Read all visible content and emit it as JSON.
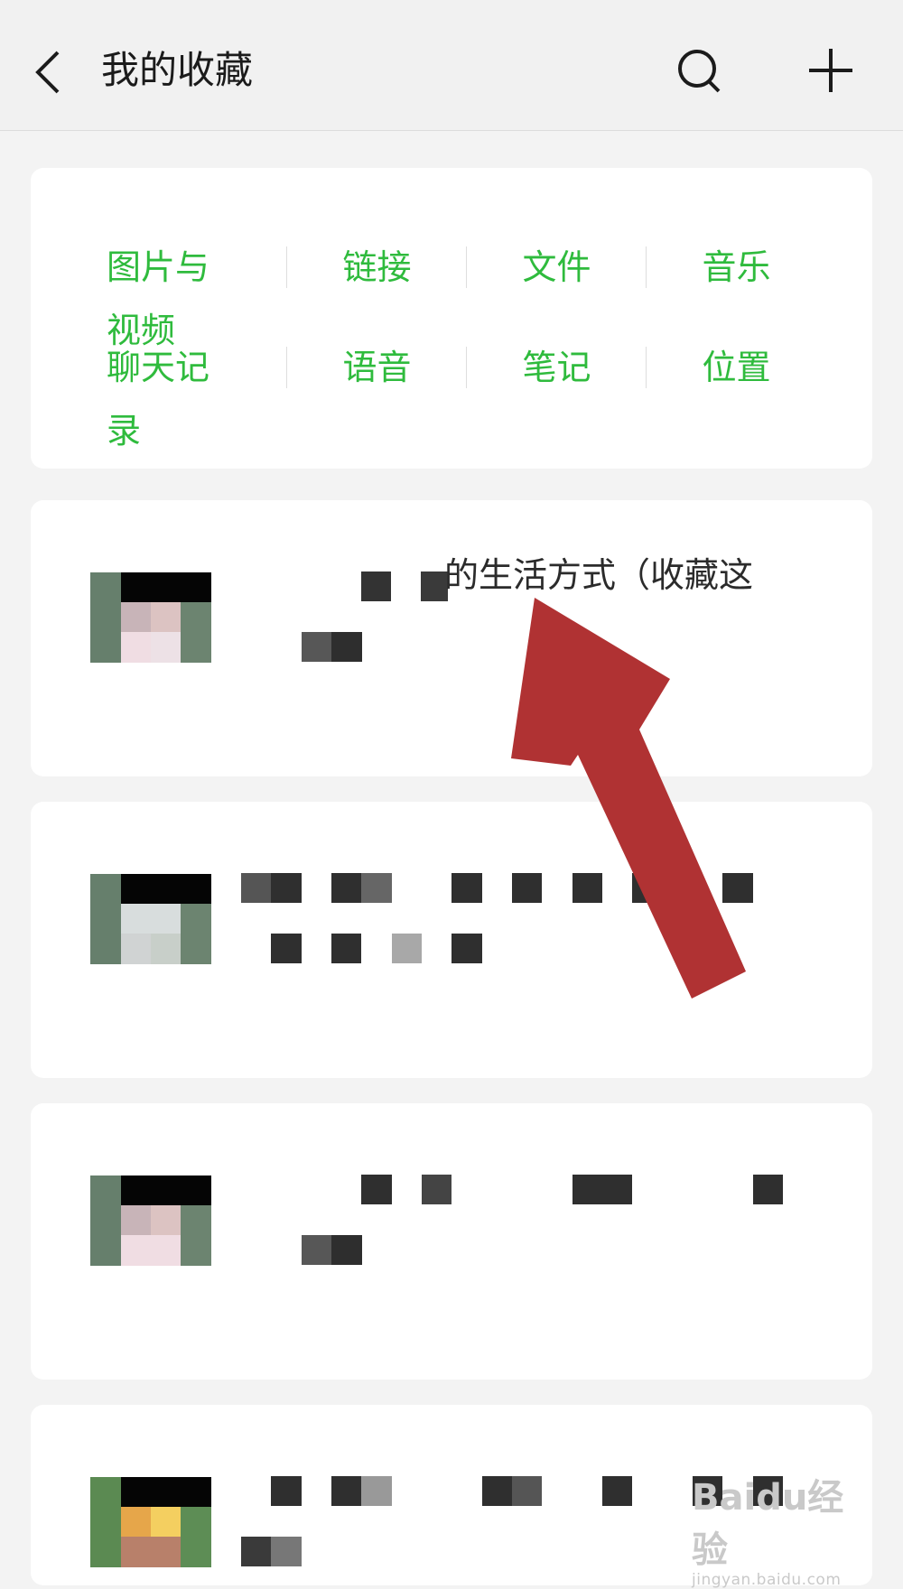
{
  "header": {
    "title": "我的收藏"
  },
  "categories": {
    "row1": [
      "图片与视频",
      "链接",
      "文件",
      "音乐"
    ],
    "row2": [
      "聊天记录",
      "语音",
      "笔记",
      "位置"
    ]
  },
  "favorites": {
    "items": [
      {
        "text": "的生活方式（收藏这"
      }
    ]
  },
  "colors": {
    "accent_green": "#2fbb3d",
    "arrow_red": "#b03233"
  },
  "icons": [
    "back-arrow-icon",
    "search-icon",
    "plus-icon"
  ],
  "watermark": {
    "text": "Baidu经验",
    "sub": "jingyan.baidu.com"
  }
}
